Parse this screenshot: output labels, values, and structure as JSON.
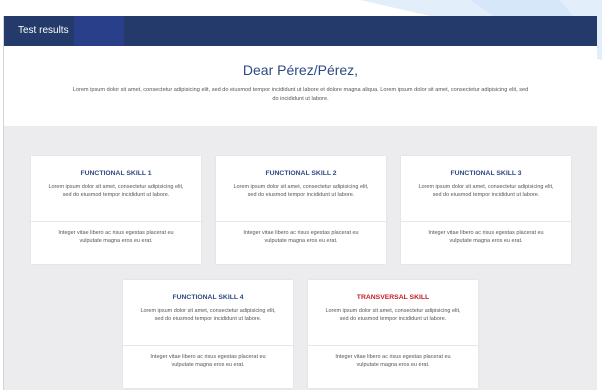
{
  "window": {
    "title": "Test results"
  },
  "header": {
    "greeting": "Dear Pérez/Pérez,",
    "intro": "Lorem ipsum dolor sit amet, consectetur adipisicing elit, sed do eiusmod tempor incididunt ut labore et dolore magna aliqua. Lorem ipsum dolor sit amet, consectetur adipisicing elit, sed do incididunt ut labore."
  },
  "cards": [
    {
      "title": "FUNCTIONAL SKILL 1",
      "body": "Lorem ipsum dolor sit amet, consectetur adipisicing elit, sed do eiusmod tempor incididunt ut labore.",
      "footer": "Integer vitae libero ac risus egestas placerat eu vulputate magna eros eu erat."
    },
    {
      "title": "FUNCTIONAL SKILL 2",
      "body": "Lorem ipsum dolor sit amet, consectetur adipisicing elit, sed do eiusmod tempor incididunt ut labore.",
      "footer": "Integer vitae libero ac risus egestas placerat eu vulputate magna eros eu erat."
    },
    {
      "title": "FUNCTIONAL SKILL 3",
      "body": "Lorem ipsum dolor sit amet, consectetur adipisicing elit, sed do eiusmod tempor incididunt ut labore.",
      "footer": "Integer vitae libero ac risus egestas placerat eu vulputate magna eros eu erat."
    },
    {
      "title": "FUNCTIONAL SKILL 4",
      "body": "Lorem ipsum dolor sit amet, consectetur adipisicing elit, sed do eiusmod tempor incididunt ut labore.",
      "footer": "Integer vitae libero ac risus egestas placerat eu vulputate magna eros eu erat."
    },
    {
      "title": "TRANSVERSAL SKILL",
      "body": "Lorem ipsum dolor sit amet, consectetur adipisicing elit, sed do eiusmod tempor incididunt ut labore.",
      "footer": "Integer vitae libero ac risus egestas placerat eu vulputate magna eros eu erat."
    }
  ],
  "colors": {
    "titlebar": "#233a6b",
    "accent_blue": "#2c4a85",
    "accent_red": "#c21d24",
    "panel_bg": "#ececee"
  }
}
